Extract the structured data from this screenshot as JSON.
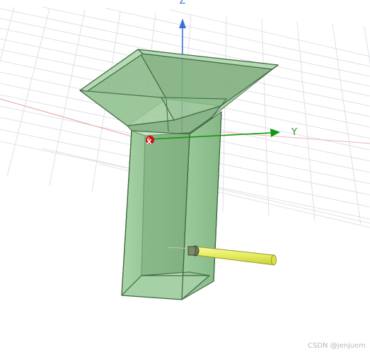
{
  "viewport": {
    "axes": {
      "z_label": "Z",
      "y_label": "Y",
      "x_label": "X",
      "z_color": "#3d6fdc",
      "y_color": "#119911",
      "x_color": "#cc1111"
    },
    "model_colors": {
      "body_fill": "#8fc08f",
      "body_edge": "#355f35",
      "probe_fill": "#e6ee6a",
      "probe_edge": "#9a9a2a"
    }
  },
  "watermark": "CSDN @jenjuem"
}
